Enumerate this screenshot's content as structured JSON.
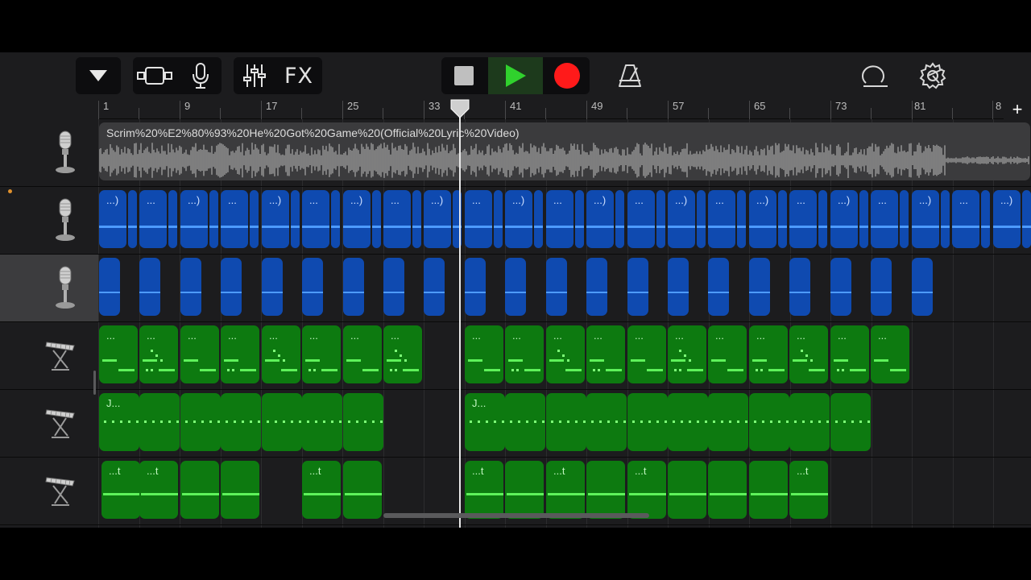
{
  "toolbar": {
    "fx_label": "FX",
    "icons": {
      "tracks_menu": "triangle-down-icon",
      "view": "track-view-icon",
      "mic": "microphone-icon",
      "mixer": "mixer-sliders-icon",
      "stop": "stop-icon",
      "play": "play-icon",
      "record": "record-icon",
      "metronome": "metronome-icon",
      "loop": "loop-browser-icon",
      "settings": "gear-icon"
    },
    "colors": {
      "play": "#30d12d",
      "record": "#ff1a1a",
      "stop": "#bfbfbf"
    }
  },
  "ruler": {
    "bars": [
      "1",
      "9",
      "17",
      "25",
      "33",
      "41",
      "49",
      "57",
      "65",
      "73",
      "81",
      "8"
    ],
    "add_label": "+"
  },
  "tracks": [
    {
      "type": "audio",
      "icon": "microphone-icon",
      "selected": false
    },
    {
      "type": "audio",
      "icon": "microphone-icon",
      "selected": false,
      "recording_dot": true
    },
    {
      "type": "audio",
      "icon": "microphone-icon",
      "selected": true
    },
    {
      "type": "keyboard",
      "icon": "keyboard-icon",
      "selected": false
    },
    {
      "type": "keyboard",
      "icon": "keyboard-icon",
      "selected": false
    },
    {
      "type": "keyboard",
      "icon": "keyboard-icon",
      "selected": false
    }
  ],
  "regions": {
    "track1_title": "Scrim%20%E2%80%93%20He%20Got%20Game%20(Official%20Lyric%20Video)",
    "track2_label": "...)",
    "track2_label_alt": "...",
    "track4_label": "...",
    "track5_label": "J...",
    "track6_label": "...t"
  },
  "colors": {
    "audio_region": "#0f4ab0",
    "midi_region": "#0d7a10",
    "waveform": "#9a9a9a"
  }
}
